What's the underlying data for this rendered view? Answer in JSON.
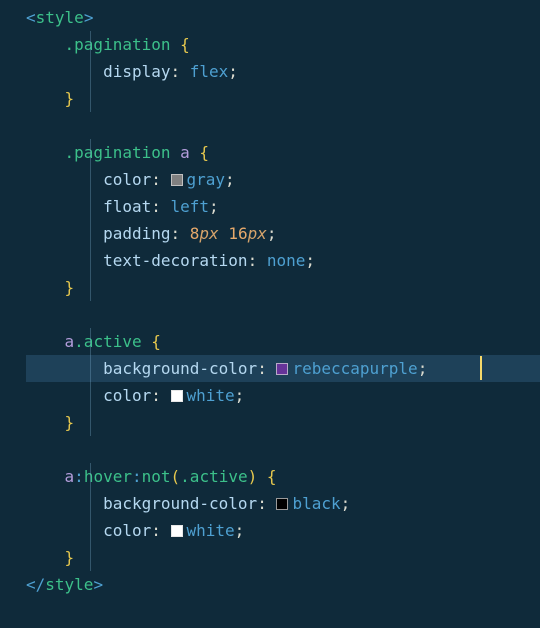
{
  "code": {
    "lines": [
      [
        {
          "t": "<",
          "c": "tok-punct"
        },
        {
          "t": "style",
          "c": "tok-tag"
        },
        {
          "t": ">",
          "c": "tok-punct"
        }
      ],
      [
        {
          "t": "    ",
          "c": ""
        },
        {
          "t": ".pagination",
          "c": "tok-selclass"
        },
        {
          "t": " ",
          "c": ""
        },
        {
          "t": "{",
          "c": "tok-brace"
        }
      ],
      [
        {
          "t": "        ",
          "c": ""
        },
        {
          "t": "display",
          "c": "tok-prop"
        },
        {
          "t": ": ",
          "c": "tok-colon"
        },
        {
          "t": "flex",
          "c": "tok-value"
        },
        {
          "t": ";",
          "c": "tok-colon"
        }
      ],
      [
        {
          "t": "    ",
          "c": ""
        },
        {
          "t": "}",
          "c": "tok-brace"
        }
      ],
      [],
      [
        {
          "t": "    ",
          "c": ""
        },
        {
          "t": ".pagination",
          "c": "tok-selclass"
        },
        {
          "t": " ",
          "c": ""
        },
        {
          "t": "a",
          "c": "tok-seltag"
        },
        {
          "t": " ",
          "c": ""
        },
        {
          "t": "{",
          "c": "tok-brace"
        }
      ],
      [
        {
          "t": "        ",
          "c": ""
        },
        {
          "t": "color",
          "c": "tok-prop"
        },
        {
          "t": ": ",
          "c": "tok-colon"
        },
        {
          "swatch": "#808080"
        },
        {
          "t": "gray",
          "c": "tok-value"
        },
        {
          "t": ";",
          "c": "tok-colon"
        }
      ],
      [
        {
          "t": "        ",
          "c": ""
        },
        {
          "t": "float",
          "c": "tok-prop"
        },
        {
          "t": ": ",
          "c": "tok-colon"
        },
        {
          "t": "left",
          "c": "tok-value"
        },
        {
          "t": ";",
          "c": "tok-colon"
        }
      ],
      [
        {
          "t": "        ",
          "c": ""
        },
        {
          "t": "padding",
          "c": "tok-prop"
        },
        {
          "t": ": ",
          "c": "tok-colon"
        },
        {
          "t": "8",
          "c": "tok-number"
        },
        {
          "t": "px",
          "c": "tok-unit"
        },
        {
          "t": " ",
          "c": ""
        },
        {
          "t": "16",
          "c": "tok-number"
        },
        {
          "t": "px",
          "c": "tok-unit"
        },
        {
          "t": ";",
          "c": "tok-colon"
        }
      ],
      [
        {
          "t": "        ",
          "c": ""
        },
        {
          "t": "text-decoration",
          "c": "tok-prop"
        },
        {
          "t": ": ",
          "c": "tok-colon"
        },
        {
          "t": "none",
          "c": "tok-value"
        },
        {
          "t": ";",
          "c": "tok-colon"
        }
      ],
      [
        {
          "t": "    ",
          "c": ""
        },
        {
          "t": "}",
          "c": "tok-brace"
        }
      ],
      [],
      [
        {
          "t": "    ",
          "c": ""
        },
        {
          "t": "a",
          "c": "tok-seltag"
        },
        {
          "t": ".active",
          "c": "tok-selclass"
        },
        {
          "t": " ",
          "c": ""
        },
        {
          "t": "{",
          "c": "tok-brace"
        }
      ],
      [
        {
          "t": "        ",
          "c": ""
        },
        {
          "t": "background-color",
          "c": "tok-prop"
        },
        {
          "t": ": ",
          "c": "tok-colon"
        },
        {
          "swatch": "#663399"
        },
        {
          "t": "rebeccapurple",
          "c": "tok-value"
        },
        {
          "t": ";",
          "c": "tok-colon"
        }
      ],
      [
        {
          "t": "        ",
          "c": ""
        },
        {
          "t": "color",
          "c": "tok-prop"
        },
        {
          "t": ": ",
          "c": "tok-colon"
        },
        {
          "swatch": "#ffffff"
        },
        {
          "t": "white",
          "c": "tok-value"
        },
        {
          "t": ";",
          "c": "tok-colon"
        }
      ],
      [
        {
          "t": "    ",
          "c": ""
        },
        {
          "t": "}",
          "c": "tok-brace"
        }
      ],
      [],
      [
        {
          "t": "    ",
          "c": ""
        },
        {
          "t": "a",
          "c": "tok-seltag"
        },
        {
          "t": ":",
          "c": "tok-selcolon"
        },
        {
          "t": "hover",
          "c": "tok-selclass"
        },
        {
          "t": ":",
          "c": "tok-selcolon"
        },
        {
          "t": "not",
          "c": "tok-selclass"
        },
        {
          "t": "(",
          "c": "tok-brace"
        },
        {
          "t": ".active",
          "c": "tok-selclass"
        },
        {
          "t": ")",
          "c": "tok-brace"
        },
        {
          "t": " ",
          "c": ""
        },
        {
          "t": "{",
          "c": "tok-brace"
        }
      ],
      [
        {
          "t": "        ",
          "c": ""
        },
        {
          "t": "background-color",
          "c": "tok-prop"
        },
        {
          "t": ": ",
          "c": "tok-colon"
        },
        {
          "swatch": "#000000"
        },
        {
          "t": "black",
          "c": "tok-value"
        },
        {
          "t": ";",
          "c": "tok-colon"
        }
      ],
      [
        {
          "t": "        ",
          "c": ""
        },
        {
          "t": "color",
          "c": "tok-prop"
        },
        {
          "t": ": ",
          "c": "tok-colon"
        },
        {
          "swatch": "#ffffff"
        },
        {
          "t": "white",
          "c": "tok-value"
        },
        {
          "t": ";",
          "c": "tok-colon"
        }
      ],
      [
        {
          "t": "    ",
          "c": ""
        },
        {
          "t": "}",
          "c": "tok-brace"
        }
      ],
      [
        {
          "t": "</",
          "c": "tok-punct"
        },
        {
          "t": "style",
          "c": "tok-tag"
        },
        {
          "t": ">",
          "c": "tok-punct"
        }
      ]
    ],
    "highlight_line": 13,
    "cursor": {
      "line": 13,
      "col": 43
    }
  }
}
